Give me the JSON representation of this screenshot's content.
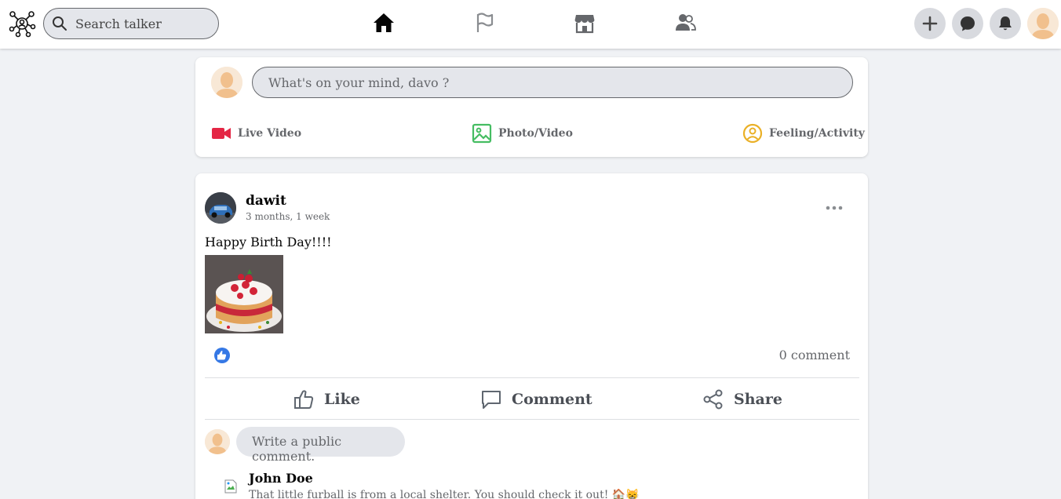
{
  "header": {
    "search_placeholder": "Search talker",
    "nav": [
      "home-icon",
      "flag-icon",
      "store-icon",
      "friends-icon"
    ],
    "actions": [
      "plus-icon",
      "messenger-icon",
      "bell-icon"
    ]
  },
  "composer": {
    "placeholder": "What's on your mind, davo ?",
    "actions": {
      "live_video": "Live Video",
      "photo_video": "Photo/Video",
      "feeling": "Feeling/Activity"
    }
  },
  "post": {
    "author": "dawit",
    "time": "3 months, 1 week",
    "text": "Happy Birth Day!!!!",
    "comment_count": "0 comment",
    "actions": {
      "like": "Like",
      "comment": "Comment",
      "share": "Share"
    },
    "comment_placeholder": "Write a public comment.",
    "comments": [
      {
        "author": "John Doe",
        "text": "That little furball is from a local shelter. You should check it out! 🏠😸"
      }
    ]
  },
  "colors": {
    "accent": "#3578e5",
    "live_video": "#e42645",
    "photo": "#45bd62",
    "feeling": "#eab026",
    "background": "#f0f2f5"
  }
}
